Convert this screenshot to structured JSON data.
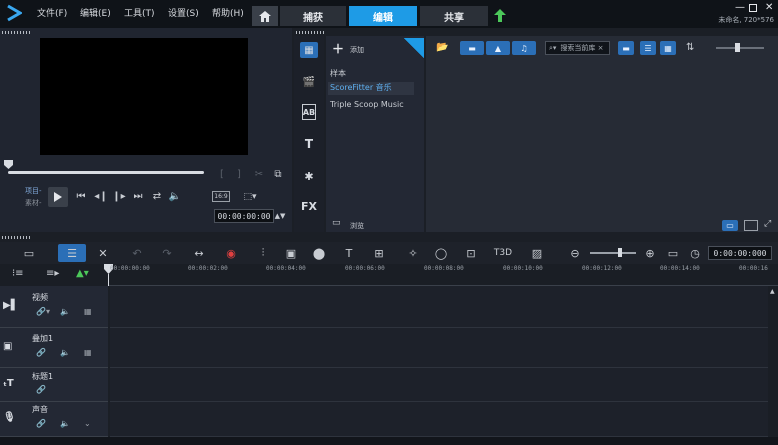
{
  "menu": {
    "file": "文件(F)",
    "edit": "编辑(E)",
    "tools": "工具(T)",
    "settings": "设置(S)",
    "help": "帮助(H)"
  },
  "tabs": {
    "capture": "捕获",
    "edit": "编辑",
    "share": "共享"
  },
  "project": {
    "info": "未命名, 720*576"
  },
  "player": {
    "project_label": "项目-",
    "clip_label": "素材-",
    "aspect": "16:9",
    "timecode": "00:00:00:00"
  },
  "library": {
    "add_label": "添加",
    "items": [
      "样本",
      "ScoreFitter 音乐",
      "Triple Scoop Music"
    ],
    "browse_label": "浏览",
    "search_placeholder": "搜索当前库 ×"
  },
  "timeline": {
    "timecode": "0:00:00:000",
    "ruler_ticks": [
      "00:00:00:00",
      "00:00:02:00",
      "00:00:04:00",
      "00:00:06:00",
      "00:00:08:00",
      "00:00:10:00",
      "00:00:12:00",
      "00:00:14:00",
      "00:00:16"
    ],
    "tracks": [
      {
        "name": "视频"
      },
      {
        "name": "叠加1"
      },
      {
        "name": "标题1"
      },
      {
        "name": "声音"
      }
    ]
  },
  "colors": {
    "accent": "#1e9be6",
    "panel": "#202530",
    "lane": "#1d212a"
  }
}
